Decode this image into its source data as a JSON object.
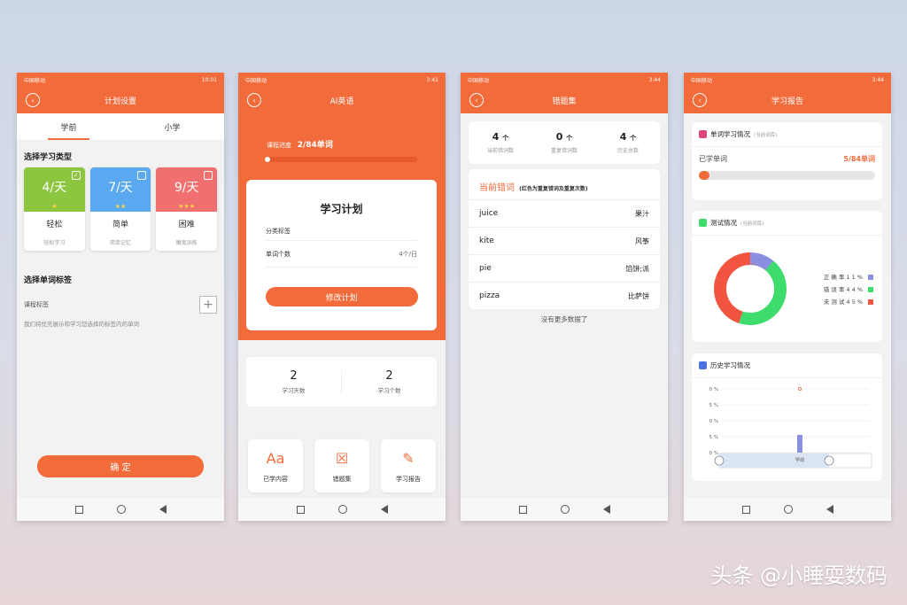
{
  "status_bars": [
    {
      "carrier": "中国移动",
      "time": "10:01"
    },
    {
      "carrier": "中国移动",
      "time": "3:41"
    },
    {
      "carrier": "中国移动",
      "time": "3:44"
    },
    {
      "carrier": "中国移动",
      "time": "3:44"
    }
  ],
  "screen1": {
    "title": "计划设置",
    "tabs": [
      "学前",
      "小学"
    ],
    "section_type": "选择学习类型",
    "types": [
      {
        "rate": "4/天",
        "stars": "★",
        "name": "轻松",
        "sub": "轻松学习",
        "color": "#8cc63f"
      },
      {
        "rate": "7/天",
        "stars": "★★",
        "name": "简单",
        "sub": "简单记忆",
        "color": "#5aa9f0"
      },
      {
        "rate": "9/天",
        "stars": "★★★",
        "name": "困难",
        "sub": "魔鬼训练",
        "color": "#f07070"
      }
    ],
    "section_tag": "选择单词标签",
    "tag_label": "课程标签",
    "hint": "我们将优先展示和学习您选择的标签内的单词",
    "confirm": "确 定"
  },
  "screen2": {
    "title": "AI英语",
    "progress_label": "课程进度",
    "progress_value": "2/84单词",
    "progress_fraction": 0.024,
    "plan_title": "学习计划",
    "row1_label": "分类标签",
    "row2_label": "单词个数",
    "row2_value": "4个/日",
    "modify": "修改计划",
    "stat1_value": "2",
    "stat1_label": "学习天数",
    "stat2_value": "2",
    "stat2_label": "学习个数",
    "icons": [
      {
        "label": "已学内容",
        "glyph": "Aa"
      },
      {
        "label": "错题集",
        "glyph": "☒"
      },
      {
        "label": "学习报告",
        "glyph": "✎"
      }
    ]
  },
  "screen3": {
    "title": "错题集",
    "stats": [
      {
        "value": "4",
        "unit": "个",
        "label": "当前错词数"
      },
      {
        "value": "0",
        "unit": "个",
        "label": "重复错词数"
      },
      {
        "value": "4",
        "unit": "个",
        "label": "历史总数"
      }
    ],
    "section_title": "当前错词",
    "section_note": "(红色为重复错词及重复次数)",
    "words": [
      {
        "en": "juice",
        "zh": "果汁"
      },
      {
        "en": "kite",
        "zh": "风筝"
      },
      {
        "en": "pie",
        "zh": "馅饼;派"
      },
      {
        "en": "pizza",
        "zh": "比萨饼"
      }
    ],
    "no_more": "没有更多数据了"
  },
  "screen4": {
    "title": "学习报告",
    "card1_title": "单词学习情况",
    "card1_note": "(当前词库)",
    "learned_label": "已学单词",
    "learned_value": "5/84单词",
    "learned_fraction": 0.06,
    "card2_title": "测试情况",
    "card2_note": "(当前词库)",
    "card3_title": "历史学习情况",
    "xtick": "学前",
    "yticks": [
      "0 %",
      "5 %",
      "0 %",
      "5 %",
      "0 %"
    ]
  },
  "chart_data": [
    {
      "type": "pie",
      "categories": [
        "正 确 率 1 1 %",
        "错 误 率 4 4 %",
        "未 测 试 4 5 %"
      ],
      "values": [
        11,
        44,
        45
      ],
      "colors": [
        "#8b8fe0",
        "#3ddc6c",
        "#f2553f"
      ]
    },
    {
      "type": "bar",
      "categories": [
        "学前"
      ],
      "values": [
        1
      ],
      "colors": [
        "#8b8fe0"
      ]
    }
  ],
  "watermark": "头条 @小睡耍数码"
}
